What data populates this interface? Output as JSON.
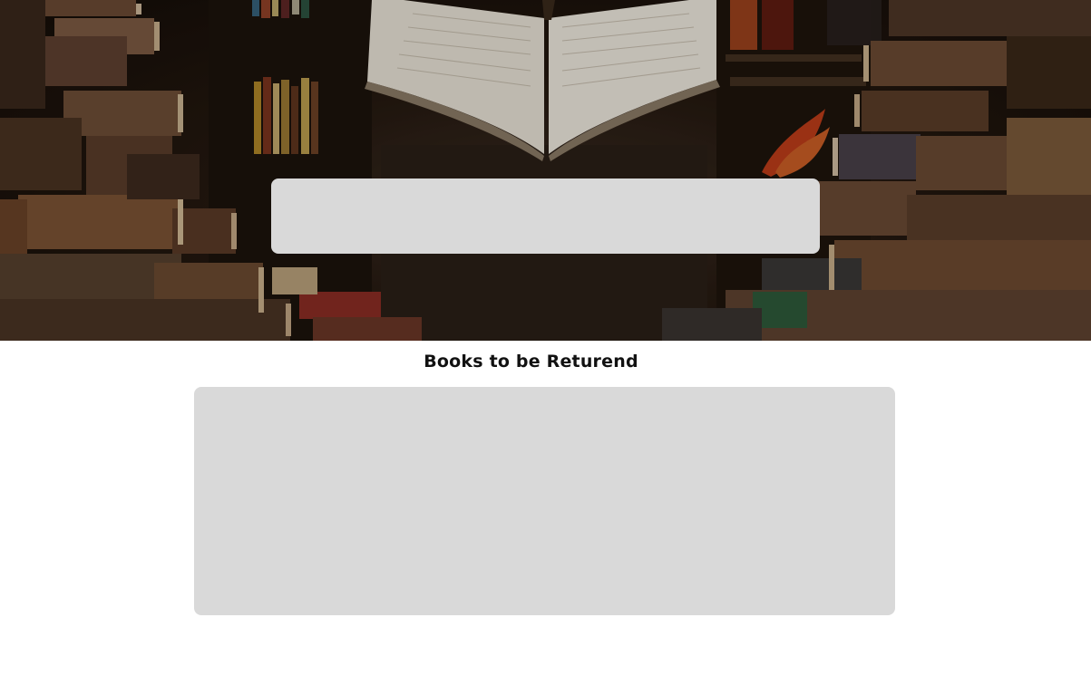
{
  "hero": {
    "image_description_icon": "open-book-library-icon"
  },
  "search": {
    "placeholder": ""
  },
  "returns": {
    "title": "Books to be Returend"
  },
  "colors": {
    "panel": "#d9d9d9",
    "title": "#111111",
    "background": "#ffffff"
  }
}
